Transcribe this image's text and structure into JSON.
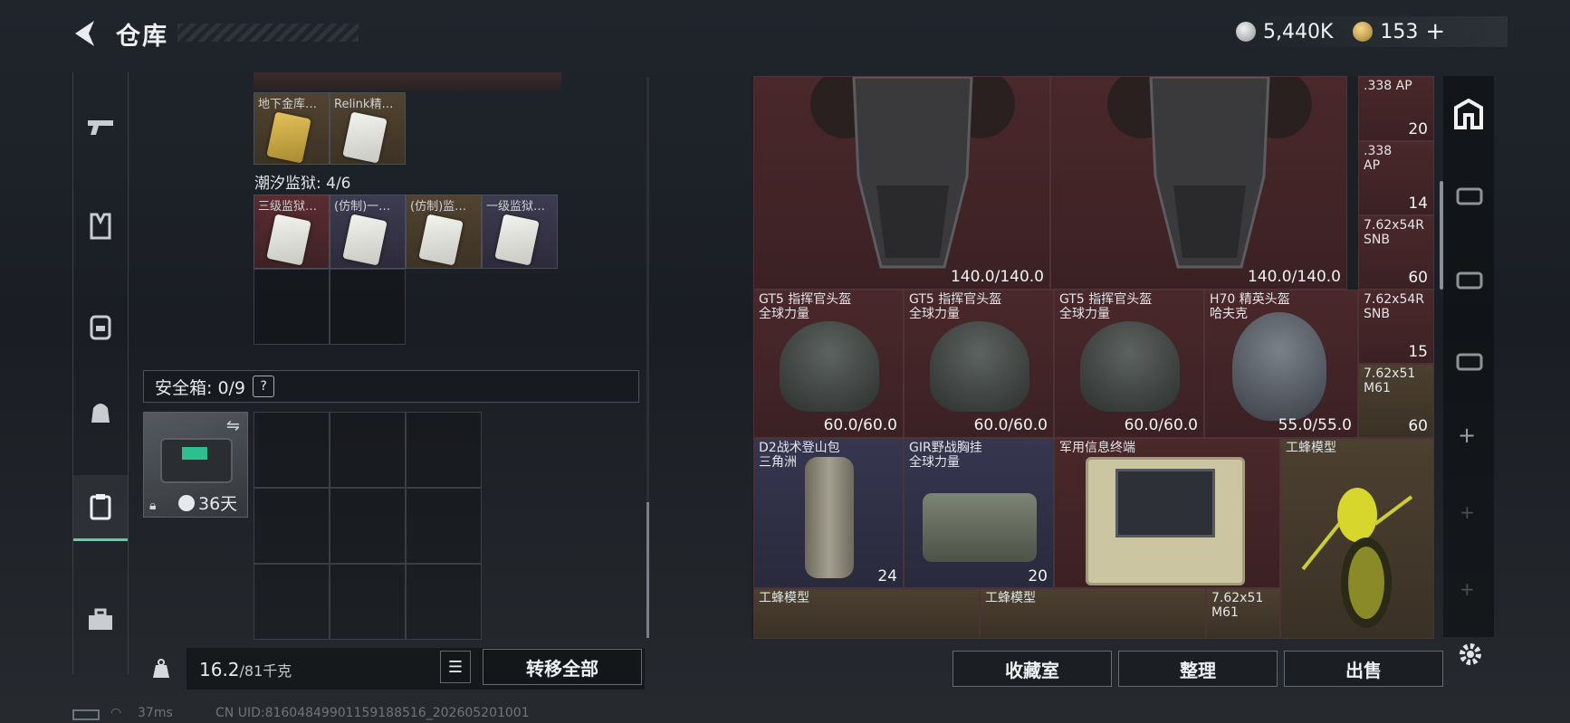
{
  "header": {
    "title": "仓库",
    "silver": "5,440K",
    "gold": "153"
  },
  "keycards": {
    "top_labels": [
      "地下金库…",
      "Relink精…"
    ],
    "section": "潮汐监狱: 4/6",
    "prison_labels": [
      "三级监狱…",
      "(仿制)一…",
      "(仿制)监…",
      "一级监狱…"
    ]
  },
  "safebox": {
    "label": "安全箱: 0/9",
    "help": "?",
    "days": "36天"
  },
  "weight": {
    "current": "16.2",
    "max": "/81千克"
  },
  "buttons": {
    "transfer_all": "转移全部",
    "collection": "收藏室",
    "sort": "整理",
    "sell": "出售"
  },
  "stash": {
    "armor": [
      {
        "durability": "140.0/140.0"
      },
      {
        "durability": "140.0/140.0"
      }
    ],
    "ammo": [
      {
        "name": ".338 AP",
        "count": "20"
      },
      {
        "name": ".338 AP",
        "count": "14"
      },
      {
        "name": "7.62x54R SNB",
        "count": "60"
      },
      {
        "name": "7.62x54R SNB",
        "count": "15"
      },
      {
        "name": "7.62x51 M61",
        "count": "60"
      },
      {
        "name": "7.62x51 M61",
        "count": ""
      }
    ],
    "helmets": [
      {
        "name": "GT5 指挥官头盔",
        "brand": "全球力量",
        "durability": "60.0/60.0"
      },
      {
        "name": "GT5 指挥官头盔",
        "brand": "全球力量",
        "durability": "60.0/60.0"
      },
      {
        "name": "GT5 指挥官头盔",
        "brand": "全球力量",
        "durability": "60.0/60.0"
      },
      {
        "name": "H70 精英头盔",
        "brand": "哈夫克",
        "durability": "55.0/55.0"
      }
    ],
    "bags": [
      {
        "name": "D2战术登山包",
        "brand": "三角洲",
        "capacity": "24"
      },
      {
        "name": "GIR野战胸挂",
        "brand": "全球力量",
        "capacity": "20"
      }
    ],
    "terminal": {
      "name": "军用信息终端"
    },
    "wasp": [
      {
        "name": "工蜂模型"
      },
      {
        "name": "工蜂模型"
      },
      {
        "name": "工蜂模型"
      }
    ]
  },
  "status": {
    "ping": "37ms",
    "uid": "CN UID:8160484990115918851​6_202605201001"
  }
}
